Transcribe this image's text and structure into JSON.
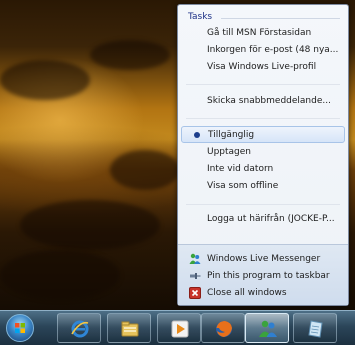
{
  "jumplist": {
    "tasks_title": "Tasks",
    "tasks": [
      {
        "label": "Gå till MSN Förstasidan"
      },
      {
        "label": "Inkorgen för e-post (48 nya..."
      },
      {
        "label": "Visa Windows Live-profil"
      }
    ],
    "send_message": "Skicka snabbmeddelande...",
    "status_options": [
      {
        "label": "Tillgänglig",
        "selected": true
      },
      {
        "label": "Upptagen",
        "selected": false
      },
      {
        "label": "Inte vid datorn",
        "selected": false
      },
      {
        "label": "Visa som offline",
        "selected": false
      }
    ],
    "logout": "Logga ut härifrån (JOCKE-P...",
    "footer": [
      {
        "label": "Windows Live Messenger",
        "icon": "messenger-icon"
      },
      {
        "label": "Pin this program to taskbar",
        "icon": "pin-icon"
      },
      {
        "label": "Close all windows",
        "icon": "close-window-icon"
      }
    ]
  },
  "taskbar": {
    "buttons": [
      {
        "name": "start-orb-icon"
      },
      {
        "name": "internet-explorer-icon"
      },
      {
        "name": "windows-explorer-icon"
      },
      {
        "name": "media-player-icon"
      },
      {
        "name": "firefox-icon"
      },
      {
        "name": "messenger-taskbar-icon",
        "active": true
      },
      {
        "name": "notepad-icon"
      }
    ]
  },
  "colors": {
    "accent": "#1e3287",
    "taskbar": "#2b4559",
    "wallpaper_glow": "#c38a1e"
  }
}
